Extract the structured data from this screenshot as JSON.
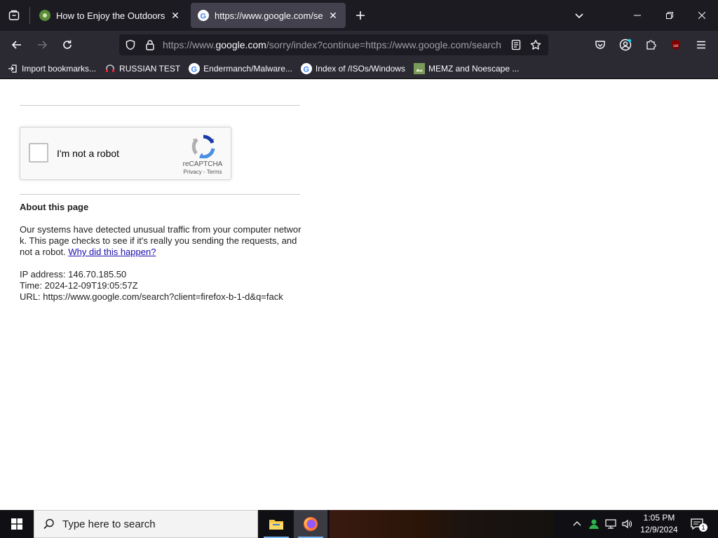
{
  "tabs": [
    {
      "title": "How to Enjoy the Outdoors (wit",
      "active": false
    },
    {
      "title": "https://www.google.com/searc",
      "active": true
    }
  ],
  "url": {
    "prefix": "https://www.",
    "host": "google.com",
    "path": "/sorry/index?continue=https://www.google.com/search?"
  },
  "bookmarks": [
    {
      "label": "Import bookmarks...",
      "icon": "import-icon"
    },
    {
      "label": "RUSSIAN TEST",
      "icon": "headset-icon"
    },
    {
      "label": "Endermanch/Malware...",
      "icon": "google-g-icon"
    },
    {
      "label": "Index of /ISOs/Windows",
      "icon": "google-g-icon"
    },
    {
      "label": "MEMZ and Noescape ...",
      "icon": "image-icon"
    }
  ],
  "captcha": {
    "label": "I'm not a robot",
    "brand": "reCAPTCHA",
    "privacy": "Privacy",
    "separator": "-",
    "terms": "Terms"
  },
  "about": {
    "title": "About this page",
    "body": "Our systems have detected unusual traffic from your computer network. This page checks to see if it's really you sending the requests, and not a robot.",
    "link": "Why did this happen?",
    "ip": "IP address: 146.70.185.50",
    "time": "Time: 2024-12-09T19:05:57Z",
    "url": "URL: https://www.google.com/search?client=firefox-b-1-d&q=fack"
  },
  "taskbar": {
    "search_placeholder": "Type here to search",
    "time": "1:05 PM",
    "date": "12/9/2024",
    "notification_count": "1"
  },
  "colors": {
    "tabstrip_bg": "#1c1b22",
    "toolbar_bg": "#2b2a33",
    "link": "#1a0dab",
    "ublock_red": "#800000"
  }
}
